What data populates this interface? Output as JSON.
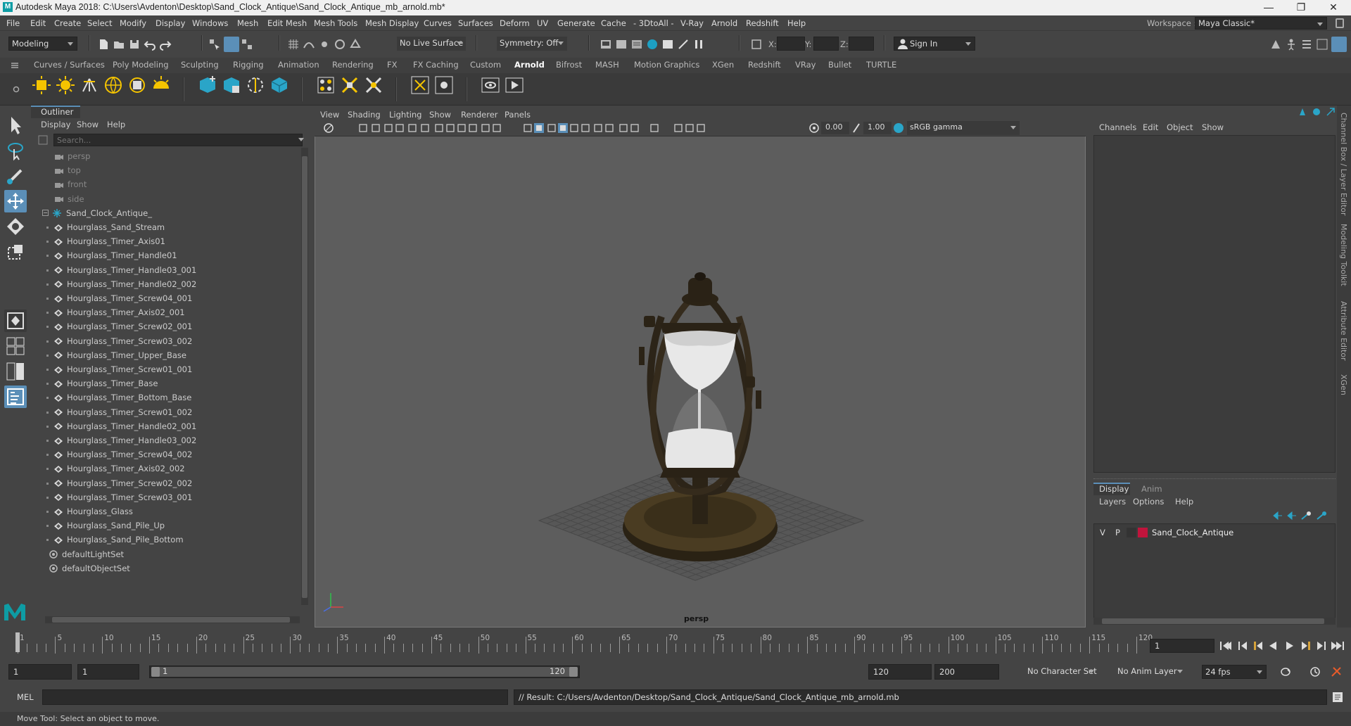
{
  "window": {
    "title": "Autodesk Maya 2018: C:\\Users\\Avdenton\\Desktop\\Sand_Clock_Antique\\Sand_Clock_Antique_mb_arnold.mb*",
    "minimize": "—",
    "maximize": "❐",
    "close": "✕"
  },
  "menu": [
    "File",
    "Edit",
    "Create",
    "Select",
    "Modify",
    "Display",
    "Windows",
    "Mesh",
    "Edit Mesh",
    "Mesh Tools",
    "Mesh Display",
    "Curves",
    "Surfaces",
    "Deform",
    "UV",
    "Generate",
    "Cache",
    "- 3DtoAll -",
    "V-Ray",
    "Arnold",
    "Redshift",
    "Help"
  ],
  "workspace": {
    "label": "Workspace :",
    "value": "Maya Classic*"
  },
  "status": {
    "mode": "Modeling",
    "live_surface": "No Live Surface",
    "symmetry": "Symmetry: Off",
    "x_label": "X:",
    "y_label": "Y:",
    "z_label": "Z:",
    "sign_in": "Sign In"
  },
  "shelf_tabs": [
    "Curves / Surfaces",
    "Poly Modeling",
    "Sculpting",
    "Rigging",
    "Animation",
    "Rendering",
    "FX",
    "FX Caching",
    "Custom",
    "Arnold",
    "Bifrost",
    "MASH",
    "Motion Graphics",
    "XGen",
    "Redshift",
    "VRay",
    "Bullet",
    "TURTLE"
  ],
  "active_shelf": "Arnold",
  "outliner": {
    "title": "Outliner",
    "menu": [
      "Display",
      "Show",
      "Help"
    ],
    "search_placeholder": "Search...",
    "cameras": [
      "persp",
      "top",
      "front",
      "side"
    ],
    "group": "Sand_Clock_Antique_",
    "children": [
      "Hourglass_Sand_Stream",
      "Hourglass_Timer_Axis01",
      "Hourglass_Timer_Handle01",
      "Hourglass_Timer_Handle03_001",
      "Hourglass_Timer_Handle02_002",
      "Hourglass_Timer_Screw04_001",
      "Hourglass_Timer_Axis02_001",
      "Hourglass_Timer_Screw02_001",
      "Hourglass_Timer_Screw03_002",
      "Hourglass_Timer_Upper_Base",
      "Hourglass_Timer_Screw01_001",
      "Hourglass_Timer_Base",
      "Hourglass_Timer_Bottom_Base",
      "Hourglass_Timer_Screw01_002",
      "Hourglass_Timer_Handle02_001",
      "Hourglass_Timer_Handle03_002",
      "Hourglass_Timer_Screw04_002",
      "Hourglass_Timer_Axis02_002",
      "Hourglass_Timer_Screw02_002",
      "Hourglass_Timer_Screw03_001",
      "Hourglass_Glass",
      "Hourglass_Sand_Pile_Up",
      "Hourglass_Sand_Pile_Bottom"
    ],
    "sets": [
      "defaultLightSet",
      "defaultObjectSet"
    ]
  },
  "viewport": {
    "menu": [
      "View",
      "Shading",
      "Lighting",
      "Show",
      "Renderer",
      "Panels"
    ],
    "exposure": "0.00",
    "gamma": "1.00",
    "color_space": "sRGB gamma",
    "camera_label": "persp"
  },
  "channelbox": {
    "menu": [
      "Channels",
      "Edit",
      "Object",
      "Show"
    ]
  },
  "layer_editor": {
    "tabs": [
      "Display",
      "Anim"
    ],
    "menu": [
      "Layers",
      "Options",
      "Help"
    ],
    "layer": {
      "v": "V",
      "p": "P",
      "name": "Sand_Clock_Antique",
      "color": "#c0143c"
    }
  },
  "side_tabs": [
    "Channel Box / Layer Editor",
    "Modeling Toolkit",
    "Attribute Editor",
    "XGen"
  ],
  "timeline": {
    "ticks": [
      "1",
      "5",
      "10",
      "15",
      "20",
      "25",
      "30",
      "35",
      "40",
      "45",
      "50",
      "55",
      "60",
      "65",
      "70",
      "75",
      "80",
      "85",
      "90",
      "95",
      "100",
      "105",
      "110",
      "115",
      "120"
    ],
    "current_frame": "1"
  },
  "range": {
    "start": "1",
    "playback_start": "1",
    "slider_start": "1",
    "slider_end": "120",
    "playback_end": "120",
    "end": "200",
    "character_set": "No Character Set",
    "anim_layer": "No Anim Layer",
    "fps": "24 fps"
  },
  "command": {
    "label": "MEL",
    "result": "// Result: C:/Users/Avdenton/Desktop/Sand_Clock_Antique/Sand_Clock_Antique_mb_arnold.mb"
  },
  "help_line": "Move Tool: Select an object to move."
}
